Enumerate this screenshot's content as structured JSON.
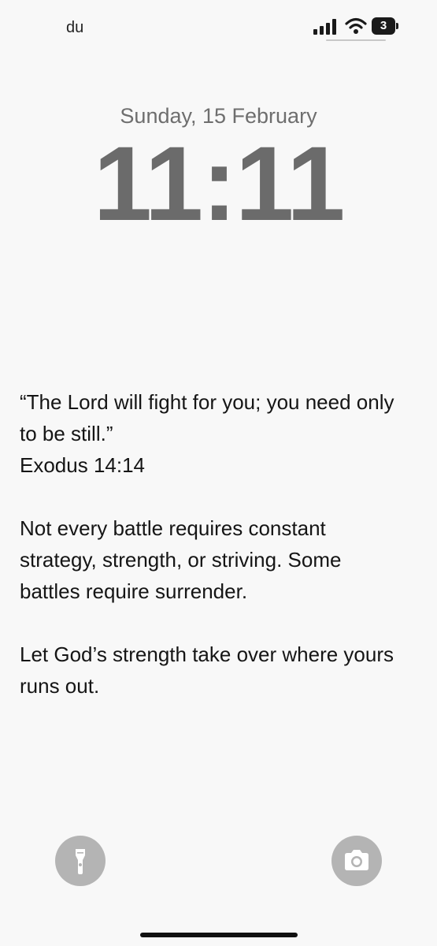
{
  "status_bar": {
    "carrier": "du",
    "battery_text": "3",
    "icons": [
      "signal-icon",
      "wifi-icon",
      "battery-icon"
    ]
  },
  "lock_screen": {
    "date": "Sunday, 15 February",
    "time": "11:11"
  },
  "wallpaper_text": {
    "quote_line1": "“The Lord will fight for you; you need only",
    "quote_line2": "to be still.”",
    "reference": "Exodus 14:14",
    "para2_line1": "Not every battle requires constant",
    "para2_line2": "strategy, strength, or striving. Some",
    "para2_line3": "battles require surrender.",
    "para3_line1": "Let God’s strength take over where yours",
    "para3_line2": "runs out."
  },
  "quick_actions": {
    "left": "flashlight-icon",
    "right": "camera-icon"
  }
}
